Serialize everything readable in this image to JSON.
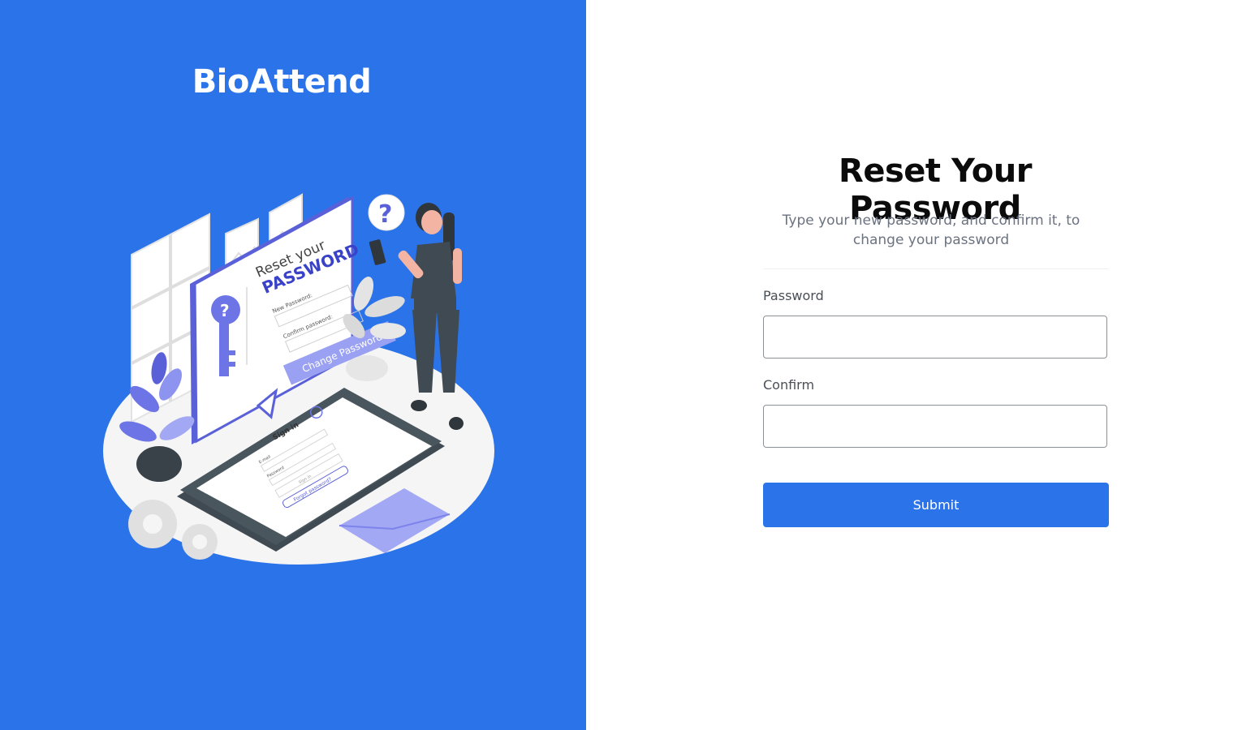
{
  "brand": {
    "name": "BioAttend"
  },
  "illustration": {
    "card_heading_line1": "Reset your",
    "card_heading_line2": "PASSWORD",
    "card_new_password_label": "New Password:",
    "card_confirm_password_label": "Confirm password:",
    "card_button_label": "Change Password",
    "phone_sign_in_label": "Sign in",
    "phone_email_label": "E-mail",
    "phone_password_label": "Password",
    "phone_sign_in_button": "Sign in",
    "phone_forgot_link": "Forgot password?",
    "question_mark": "?",
    "colors": {
      "accent": "#6c74e6",
      "light_accent": "#a3a8f4",
      "dark": "#3f4a52"
    }
  },
  "form": {
    "title": "Reset Your Password",
    "subtitle": "Type your new password, and confirm it, to change your password",
    "password_label": "Password",
    "password_value": "",
    "confirm_label": "Confirm",
    "confirm_value": "",
    "submit_label": "Submit"
  },
  "colors": {
    "primary": "#2b73e9",
    "title_text": "#0b0b0b",
    "subtitle_text": "#6b7280",
    "input_border": "#8c9199"
  }
}
